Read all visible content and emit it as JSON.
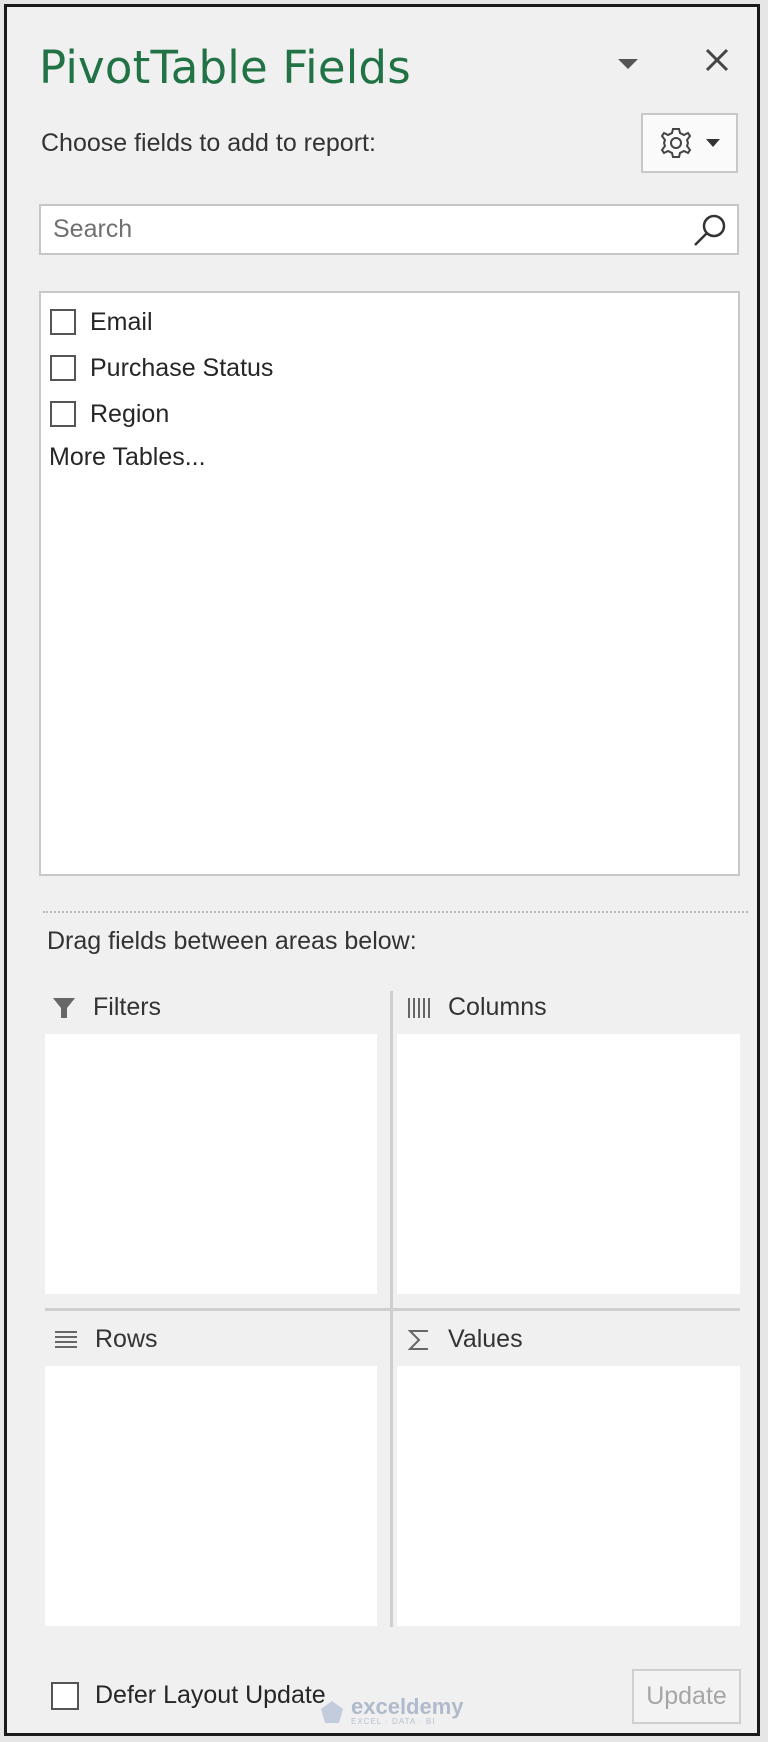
{
  "pane": {
    "title": "PivotTable Fields",
    "subtitle": "Choose fields to add to report:",
    "search_placeholder": "Search"
  },
  "fields": [
    {
      "label": "Email",
      "checked": false
    },
    {
      "label": "Purchase Status",
      "checked": false
    },
    {
      "label": "Region",
      "checked": false
    }
  ],
  "more_tables": "More Tables...",
  "areas": {
    "instruction": "Drag fields between areas below:",
    "filters": "Filters",
    "columns": "Columns",
    "rows": "Rows",
    "values": "Values"
  },
  "footer": {
    "defer_label": "Defer Layout Update",
    "update_label": "Update"
  },
  "watermark": {
    "name": "exceldemy",
    "tagline": "EXCEL · DATA · BI"
  },
  "icons": {
    "menu_caret": "chevron-down-icon",
    "close": "close-icon",
    "settings": "gear-icon",
    "search": "search-icon",
    "filters": "filter-icon",
    "columns": "columns-icon",
    "rows": "rows-icon",
    "values": "sigma-icon"
  },
  "colors": {
    "title": "#217346",
    "pane_bg": "#f0f0f0",
    "update_disabled": "#a6a6a6"
  }
}
